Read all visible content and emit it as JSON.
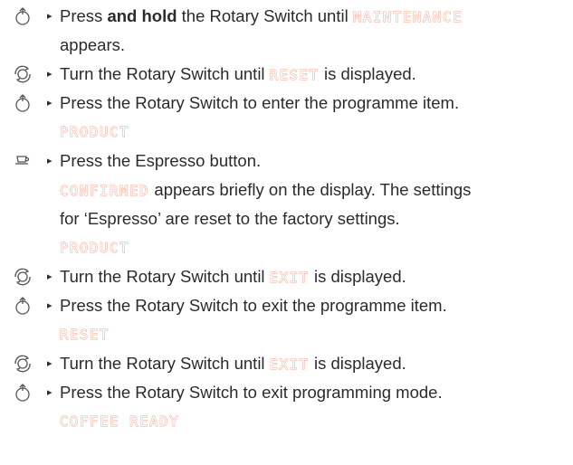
{
  "colors": {
    "text": "#2b2b2b",
    "lcd": "#f2a38c",
    "icon": "#555555"
  },
  "bullet_glyph": "▸",
  "steps": [
    {
      "icon": "press-icon",
      "pre": "Press ",
      "bold": "and hold",
      "post": " the Rotary Switch until ",
      "lcd": "MAINTENANCE",
      "cont": "appears."
    },
    {
      "icon": "rotate-icon",
      "pre": "Turn the Rotary Switch until ",
      "lcd": "RESET",
      "post": " is displayed."
    },
    {
      "icon": "press-icon",
      "text": "Press the Rotary Switch to enter the programme item.",
      "display": "PRODUCT"
    },
    {
      "icon": "cup-icon",
      "text": "Press the Espresso button.",
      "lcd": "CONFIRMED",
      "after": " appears briefly on the display. The settings",
      "line3": "for ‘Espresso’ are reset to the factory settings.",
      "display": "PRODUCT"
    },
    {
      "icon": "rotate-icon",
      "pre": "Turn the Rotary Switch until ",
      "lcd": "EXIT",
      "post": " is displayed."
    },
    {
      "icon": "press-icon",
      "text": "Press the Rotary Switch to exit the programme item.",
      "display": "RESET"
    },
    {
      "icon": "rotate-icon",
      "pre": "Turn the Rotary Switch until ",
      "lcd": "EXIT",
      "post": " is displayed."
    },
    {
      "icon": "press-icon",
      "text": "Press the Rotary Switch to exit programming mode.",
      "display": "COFFEE READY"
    }
  ]
}
